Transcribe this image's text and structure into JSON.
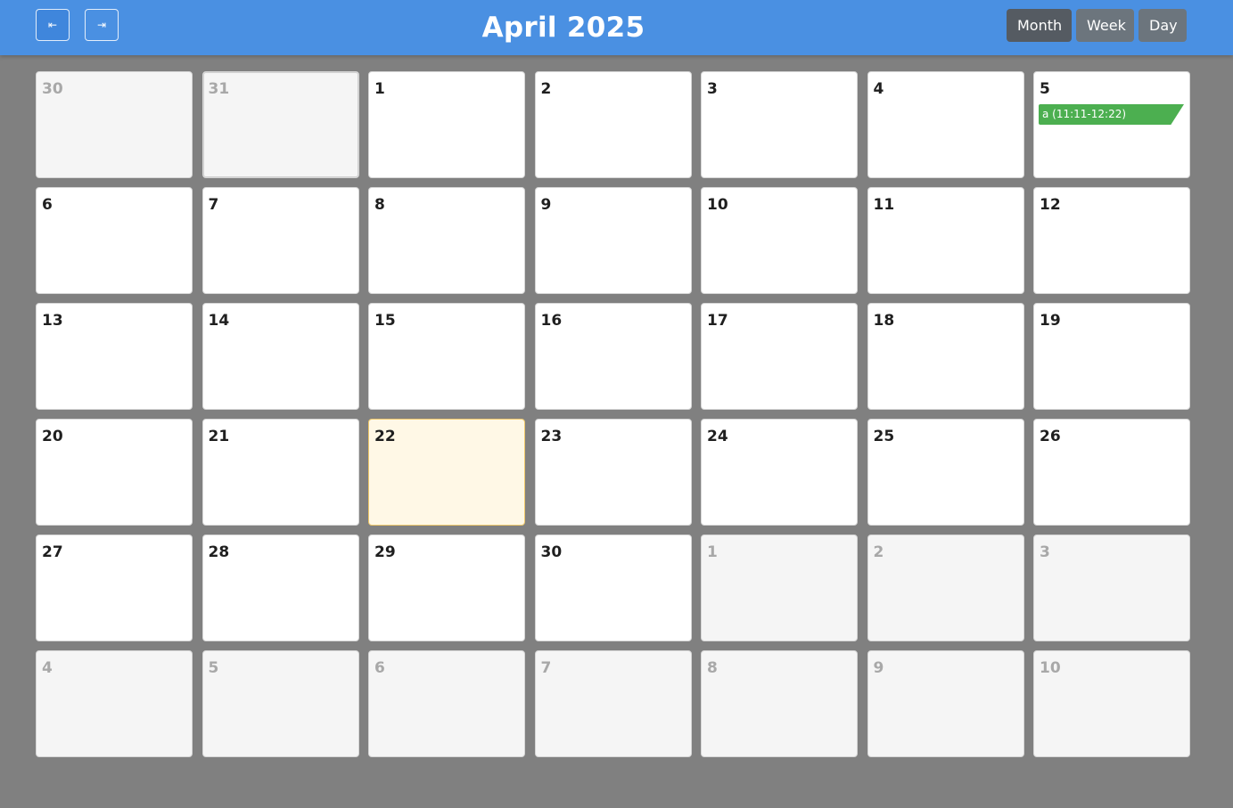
{
  "header": {
    "title": "April 2025",
    "prev_icon": "⇤",
    "next_icon": "⇥",
    "views": [
      "Month",
      "Week",
      "Day"
    ],
    "active_view": "Month",
    "color": "#4a90e2"
  },
  "weeks": [
    [
      {
        "day": "30",
        "current": false
      },
      {
        "day": "31",
        "current": false
      },
      {
        "day": "1",
        "current": true
      },
      {
        "day": "2",
        "current": true
      },
      {
        "day": "3",
        "current": true
      },
      {
        "day": "4",
        "current": true
      },
      {
        "day": "5",
        "current": true,
        "event": "a (11:11-12:22)"
      }
    ],
    [
      {
        "day": "6",
        "current": true
      },
      {
        "day": "7",
        "current": true
      },
      {
        "day": "8",
        "current": true
      },
      {
        "day": "9",
        "current": true
      },
      {
        "day": "10",
        "current": true
      },
      {
        "day": "11",
        "current": true
      },
      {
        "day": "12",
        "current": true
      }
    ],
    [
      {
        "day": "13",
        "current": true
      },
      {
        "day": "14",
        "current": true
      },
      {
        "day": "15",
        "current": true
      },
      {
        "day": "16",
        "current": true
      },
      {
        "day": "17",
        "current": true
      },
      {
        "day": "18",
        "current": true
      },
      {
        "day": "19",
        "current": true
      }
    ],
    [
      {
        "day": "20",
        "current": true
      },
      {
        "day": "21",
        "current": true
      },
      {
        "day": "22",
        "current": true,
        "today": true
      },
      {
        "day": "23",
        "current": true
      },
      {
        "day": "24",
        "current": true
      },
      {
        "day": "25",
        "current": true
      },
      {
        "day": "26",
        "current": true
      }
    ],
    [
      {
        "day": "27",
        "current": true
      },
      {
        "day": "28",
        "current": true
      },
      {
        "day": "29",
        "current": true
      },
      {
        "day": "30",
        "current": true
      },
      {
        "day": "1",
        "current": false
      },
      {
        "day": "2",
        "current": false
      },
      {
        "day": "3",
        "current": false
      }
    ],
    [
      {
        "day": "4",
        "current": false
      },
      {
        "day": "5",
        "current": false
      },
      {
        "day": "6",
        "current": false
      },
      {
        "day": "7",
        "current": false
      },
      {
        "day": "8",
        "current": false
      },
      {
        "day": "9",
        "current": false
      },
      {
        "day": "10",
        "current": false
      }
    ]
  ],
  "event_color": "#4caf50",
  "today_color": "#fff8e6"
}
